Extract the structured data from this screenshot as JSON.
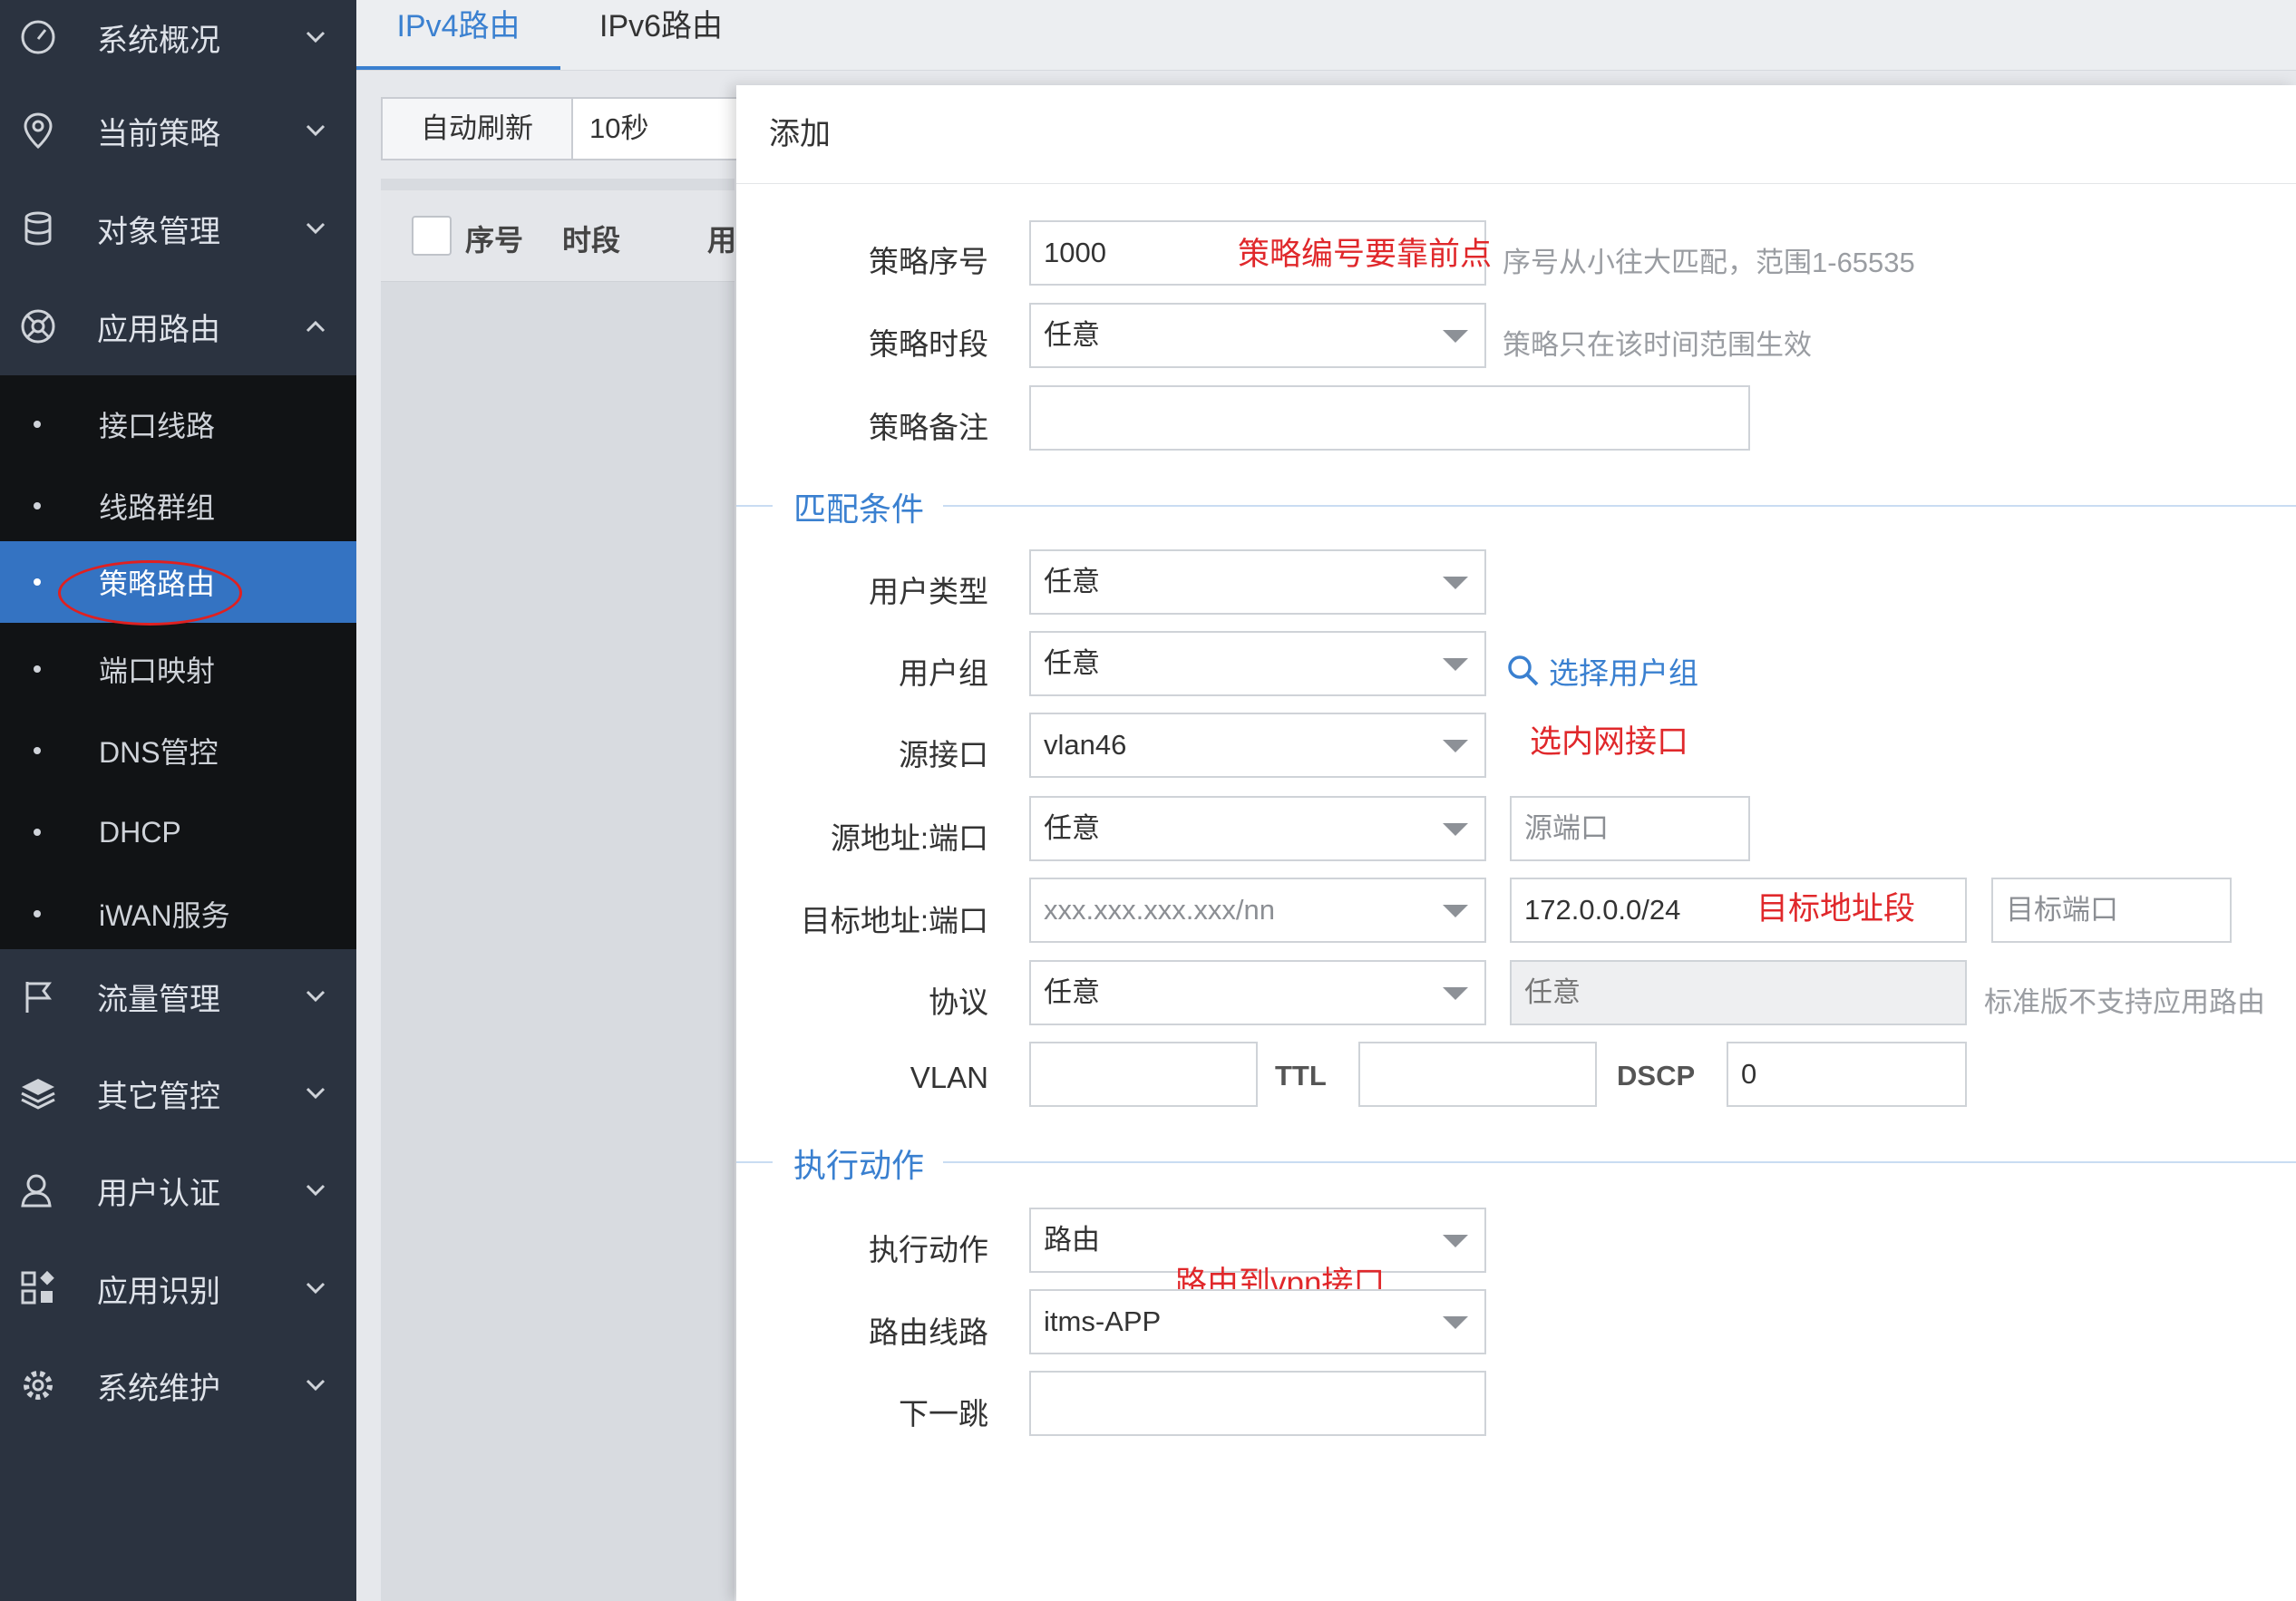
{
  "sidebar": {
    "items": [
      {
        "label": "系统概况",
        "icon": "dashboard-icon"
      },
      {
        "label": "当前策略",
        "icon": "location-pin-icon"
      },
      {
        "label": "对象管理",
        "icon": "database-icon"
      },
      {
        "label": "应用路由",
        "icon": "route-icon"
      },
      {
        "label": "流量管理",
        "icon": "flag-icon"
      },
      {
        "label": "其它管控",
        "icon": "layers-icon"
      },
      {
        "label": "用户认证",
        "icon": "user-icon"
      },
      {
        "label": "应用识别",
        "icon": "apps-icon"
      },
      {
        "label": "系统维护",
        "icon": "gear-icon"
      }
    ],
    "submenu": [
      "接口线路",
      "线路群组",
      "策略路由",
      "端口映射",
      "DNS管控",
      "DHCP",
      "iWAN服务"
    ]
  },
  "tabs": [
    "IPv4路由",
    "IPv6路由"
  ],
  "toolbar": {
    "refresh": "自动刷新",
    "interval": "10秒"
  },
  "list": {
    "col_seq": "序号",
    "col_period": "时段",
    "col_user": "用"
  },
  "dialog": {
    "title": "添加",
    "fields": {
      "seq": {
        "label": "策略序号",
        "value": "1000",
        "hint": "序号从小往大匹配，范围1-65535"
      },
      "period": {
        "label": "策略时段",
        "value": "任意",
        "hint": "策略只在该时间范围生效"
      },
      "remark": {
        "label": "策略备注",
        "value": ""
      },
      "user_type": {
        "label": "用户类型",
        "value": "任意"
      },
      "user_group": {
        "label": "用户组",
        "value": "任意",
        "link": "选择用户组"
      },
      "src_if": {
        "label": "源接口",
        "value": "vlan46"
      },
      "src_addr": {
        "label": "源地址:端口",
        "value": "任意",
        "port_placeholder": "源端口"
      },
      "dst_addr": {
        "label": "目标地址:端口",
        "value": "xxx.xxx.xxx.xxx/nn",
        "addr_value": "172.0.0.0/24",
        "port_placeholder": "目标端口"
      },
      "protocol": {
        "label": "协议",
        "value": "任意",
        "app_value": "任意",
        "hint": "标准版不支持应用路由"
      },
      "vlan": {
        "label": "VLAN",
        "value": ""
      },
      "ttl": {
        "label": "TTL",
        "value": ""
      },
      "dscp": {
        "label": "DSCP",
        "value": "0"
      },
      "action": {
        "label": "执行动作",
        "value": "路由"
      },
      "route_line": {
        "label": "路由线路",
        "value": "itms-APP"
      },
      "next_hop": {
        "label": "下一跳",
        "value": ""
      }
    },
    "sections": {
      "match": "匹配条件",
      "action": "执行动作"
    }
  },
  "annotations": {
    "seq": "策略编号要靠前点",
    "src_if": "选内网接口",
    "dst": "目标地址段",
    "route": "路由到vpn接口"
  },
  "colors": {
    "sidebar_bg": "#2b3340",
    "submenu_bg": "#111315",
    "active": "#3473c2",
    "accent": "#3a80d0",
    "annotation": "#e0282b"
  }
}
